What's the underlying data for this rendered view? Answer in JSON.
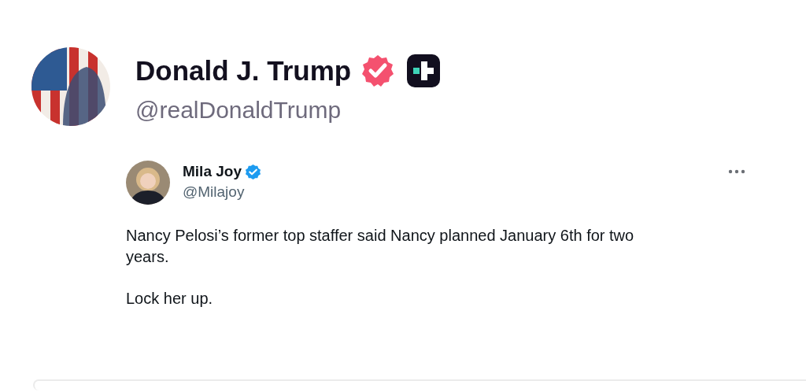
{
  "author": {
    "name": "Donald J. Trump",
    "handle": "@realDonaldTrump"
  },
  "quoted_post": {
    "author_name": "Mila Joy",
    "handle": "@Milajoy",
    "paragraphs": [
      "Nancy Pelosi’s former top staffer said Nancy planned January 6th for two years.",
      "Lock her up."
    ]
  }
}
